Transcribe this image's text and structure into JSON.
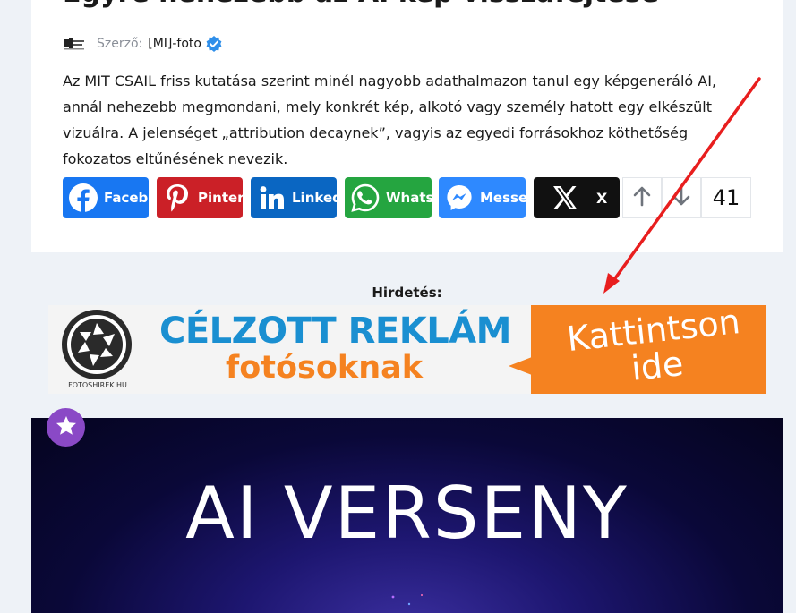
{
  "article": {
    "title": "Egyre nehezebb az AI kép visszafejtése",
    "author_label": "Szerző:",
    "author_name": "[MI]-foto",
    "excerpt": "Az MIT CSAIL friss kutatása szerint minél nagyobb adathalmazon tanul egy képgeneráló AI, annál nehezebb megmondani, mely konkrét kép, alkotó vagy személy hatott egy elkészült vizuálra. A jelenséget „attribution decaynek”, vagyis az egyedi forrásokhoz köthetőség fokozatos eltűnésének nevezik."
  },
  "share": {
    "facebook": "Faceb",
    "pinterest": "Pinter",
    "linkedin": "Linked",
    "whatsapp": "Whats",
    "messenger": "Messe",
    "x": "X",
    "vote_count": "41"
  },
  "ad": {
    "label": "Hirdetés:",
    "logo_text": "FOTOSHIREK.HU",
    "headline": "CÉLZOTT REKLÁM",
    "subline": "fotósoknak",
    "cta_line1": "Kattintson",
    "cta_line2": "ide"
  },
  "hero": {
    "title": "AI VERSENY"
  },
  "colors": {
    "facebook": "#1877f2",
    "pinterest": "#cb2027",
    "linkedin": "#0a66c2",
    "whatsapp": "#25a540",
    "messenger": "#2e89ff",
    "x": "#111111",
    "badge": "#8a49c6",
    "arrow": "#e81e1e"
  },
  "icons": {
    "author_logo": "author-logo-icon",
    "verified": "verified-check-icon",
    "upvote": "arrow-up-icon",
    "downvote": "arrow-down-icon",
    "badge": "star-icon"
  }
}
